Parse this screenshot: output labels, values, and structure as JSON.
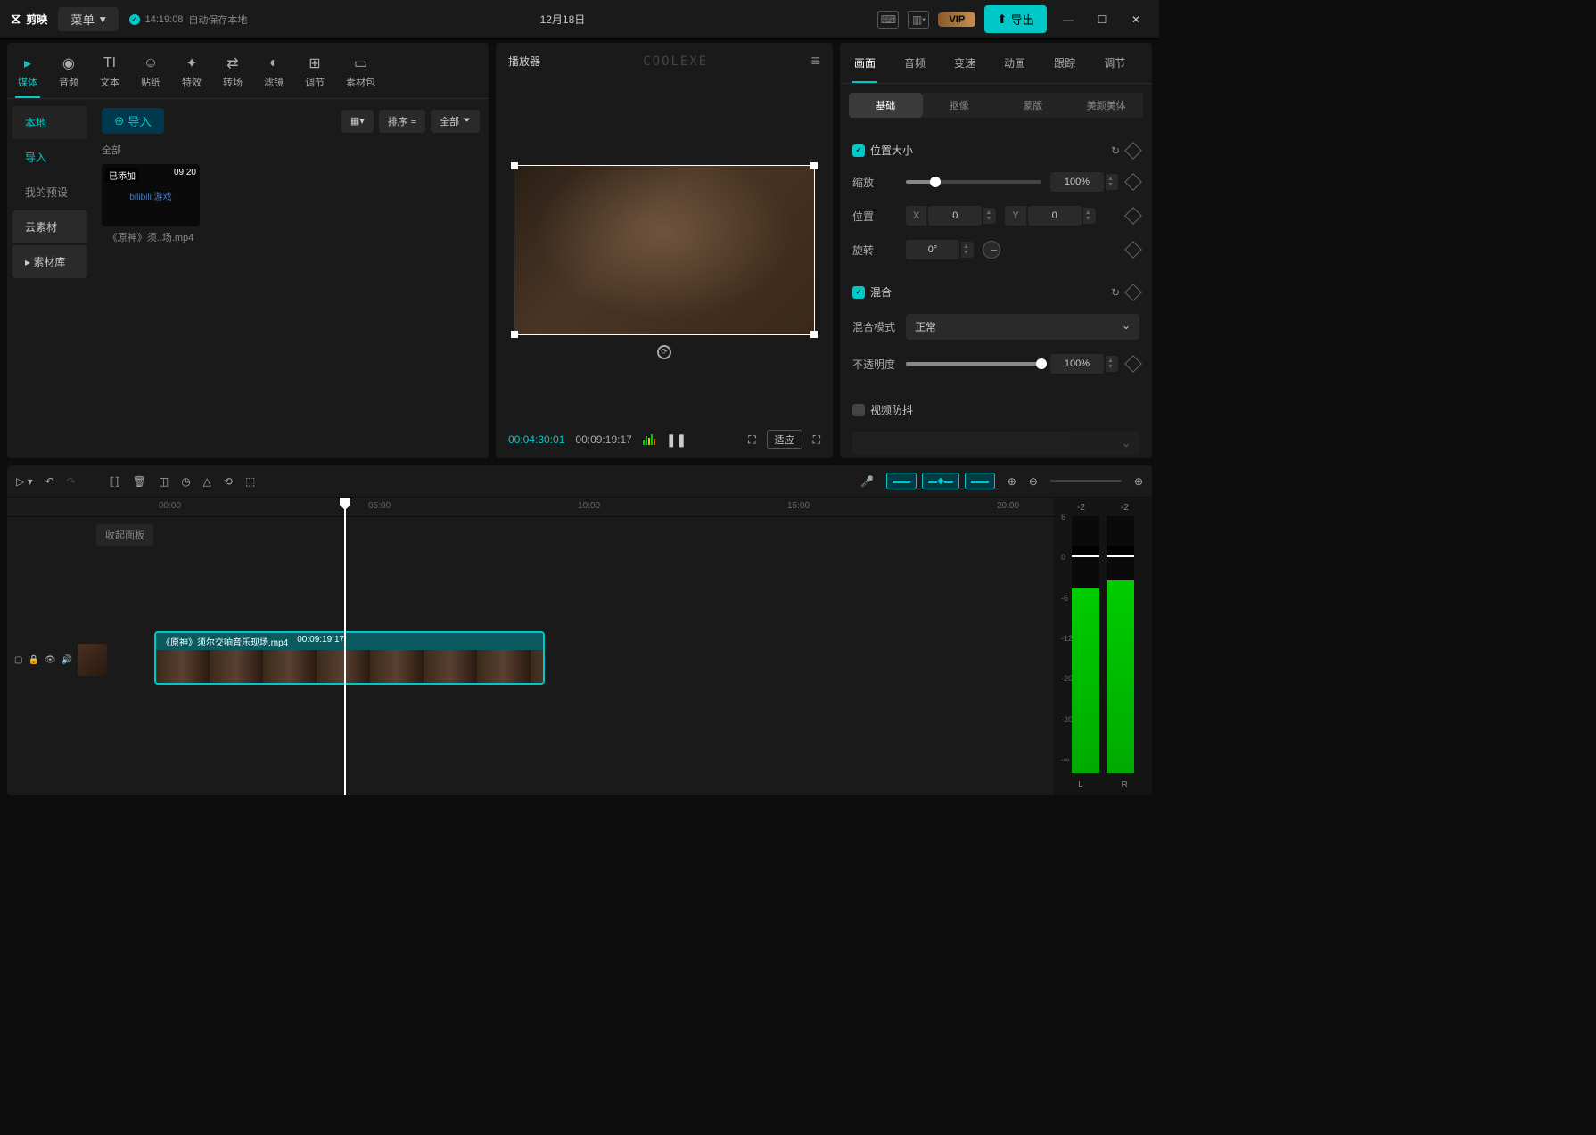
{
  "titlebar": {
    "app_name": "剪映",
    "menu": "菜单",
    "autosave_time": "14:19:08",
    "autosave_text": "自动保存本地",
    "project_title": "12月18日",
    "vip": "VIP",
    "export": "导出"
  },
  "media_tabs": [
    {
      "icon": "▸",
      "label": "媒体"
    },
    {
      "icon": "◉",
      "label": "音频"
    },
    {
      "icon": "TI",
      "label": "文本"
    },
    {
      "icon": "☺",
      "label": "贴纸"
    },
    {
      "icon": "✦",
      "label": "特效"
    },
    {
      "icon": "⇄",
      "label": "转场"
    },
    {
      "icon": "◐",
      "label": "滤镜"
    },
    {
      "icon": "⊞",
      "label": "调节"
    },
    {
      "icon": "▭",
      "label": "素材包"
    }
  ],
  "media_sidebar": {
    "local": "本地",
    "import": "导入",
    "preset": "我的预设",
    "cloud": "云素材",
    "library": "素材库"
  },
  "media_toolbar": {
    "import_btn": "导入",
    "sort": "排序",
    "all": "全部",
    "category": "全部"
  },
  "clip": {
    "badge": "已添加",
    "duration": "09:20",
    "thumb_text": "bilibili 游戏",
    "name": "《原神》须..场.mp4"
  },
  "preview": {
    "title": "播放器",
    "logo": "COOLEXE",
    "current_time": "00:04:30:01",
    "total_time": "00:09:19:17",
    "fit": "适应"
  },
  "props_tabs": [
    "画面",
    "音频",
    "变速",
    "动画",
    "跟踪",
    "调节"
  ],
  "props_subtabs": [
    "基础",
    "抠像",
    "蒙版",
    "美颜美体"
  ],
  "props": {
    "position_size": "位置大小",
    "scale": "缩放",
    "scale_value": "100%",
    "position": "位置",
    "pos_x": "0",
    "pos_y": "0",
    "rotation": "旋转",
    "rotation_value": "0°",
    "blend": "混合",
    "blend_mode": "混合模式",
    "blend_mode_value": "正常",
    "opacity": "不透明度",
    "opacity_value": "100%",
    "stabilize": "视频防抖"
  },
  "timeline": {
    "ruler": [
      "00:00",
      "05:00",
      "10:00",
      "15:00",
      "20:00"
    ],
    "collapse": "收起面板",
    "clip_name": "《原神》须尔交响音乐现场.mp4",
    "clip_duration": "00:09:19:17",
    "meter_top": [
      "-2",
      "-2"
    ],
    "meter_scale": [
      "6",
      "0",
      "-6",
      "-12",
      "-20",
      "-30",
      "-∞"
    ],
    "meter_labels": [
      "L",
      "R"
    ]
  }
}
